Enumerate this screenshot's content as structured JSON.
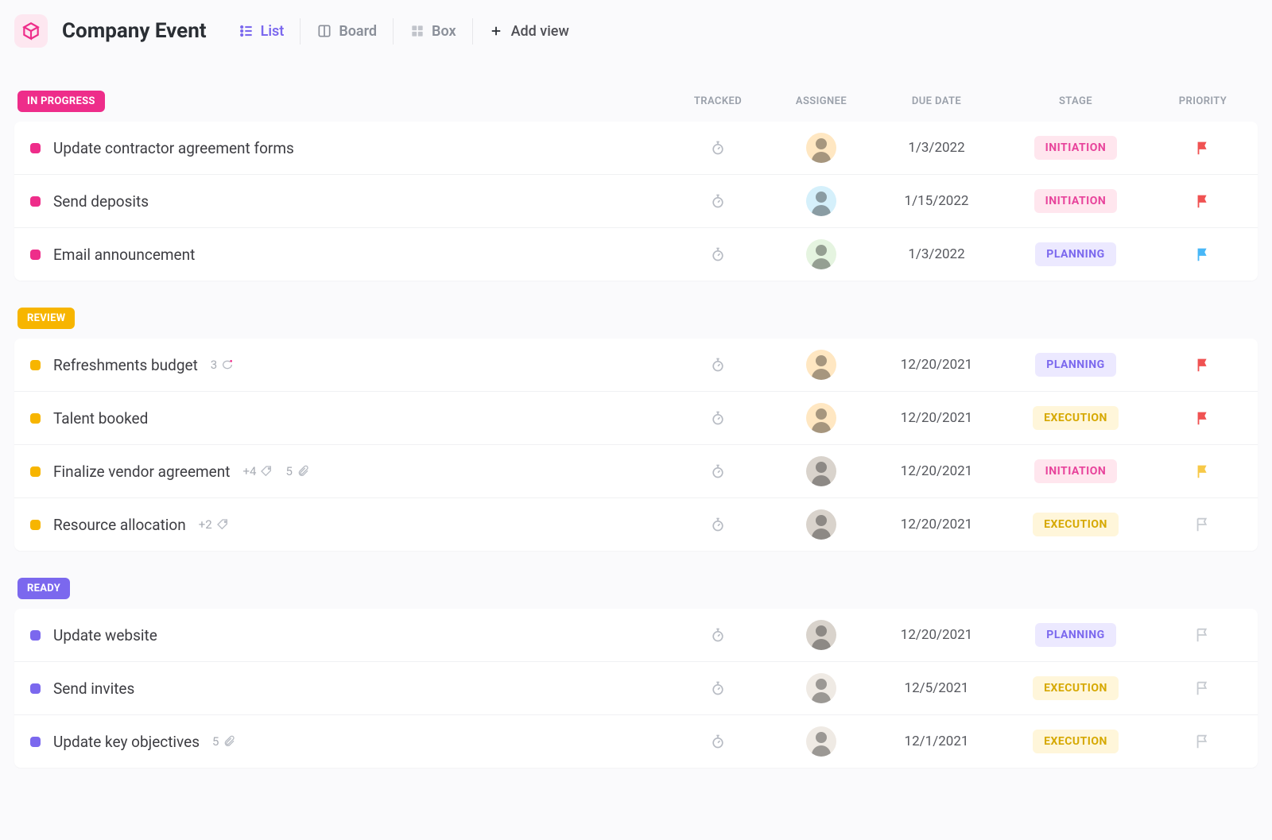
{
  "header": {
    "space_title": "Company Event",
    "views": [
      {
        "label": "List",
        "active": true
      },
      {
        "label": "Board",
        "active": false
      },
      {
        "label": "Box",
        "active": false
      }
    ],
    "add_view_label": "Add view"
  },
  "columns": {
    "tracked": "TRACKED",
    "assignee": "ASSIGNEE",
    "due_date": "DUE DATE",
    "stage": "STAGE",
    "priority": "PRIORITY"
  },
  "stages": {
    "INITIATION": {
      "bg": "#ffe6ee",
      "fg": "#e8439b"
    },
    "PLANNING": {
      "bg": "#ece9ff",
      "fg": "#7b68ee"
    },
    "EXECUTION": {
      "bg": "#fff6da",
      "fg": "#d6a800"
    }
  },
  "priorities": {
    "urgent": "#f05252",
    "normal": "#48b7f7",
    "medium": "#f7c948",
    "none": "#c7cbd1"
  },
  "avatars": {
    "a1": "#ffe7c2",
    "a2": "#d5f0fb",
    "a3": "#e5f4e0",
    "a4": "#ffe7c2",
    "a5": "#d9d3cc",
    "a6": "#efeae4"
  },
  "sections": [
    {
      "status_label": "IN PROGRESS",
      "status_color": "#ee2d8a",
      "tasks": [
        {
          "name": "Update contractor agreement forms",
          "due": "1/3/2022",
          "stage": "INITIATION",
          "priority": "urgent",
          "avatar": "a1"
        },
        {
          "name": "Send deposits",
          "due": "1/15/2022",
          "stage": "INITIATION",
          "priority": "urgent",
          "avatar": "a2"
        },
        {
          "name": "Email announcement",
          "due": "1/3/2022",
          "stage": "PLANNING",
          "priority": "normal",
          "avatar": "a3"
        }
      ]
    },
    {
      "status_label": "REVIEW",
      "status_color": "#f7b500",
      "tasks": [
        {
          "name": "Refreshments budget",
          "due": "12/20/2021",
          "stage": "PLANNING",
          "priority": "urgent",
          "avatar": "a4",
          "comments": "3"
        },
        {
          "name": "Talent booked",
          "due": "12/20/2021",
          "stage": "EXECUTION",
          "priority": "urgent",
          "avatar": "a4"
        },
        {
          "name": "Finalize vendor agreement",
          "due": "12/20/2021",
          "stage": "INITIATION",
          "priority": "medium",
          "avatar": "a5",
          "tags": "+4",
          "attachments": "5"
        },
        {
          "name": "Resource allocation",
          "due": "12/20/2021",
          "stage": "EXECUTION",
          "priority": "none",
          "avatar": "a5",
          "tags": "+2"
        }
      ]
    },
    {
      "status_label": "READY",
      "status_color": "#7b68ee",
      "tasks": [
        {
          "name": "Update website",
          "due": "12/20/2021",
          "stage": "PLANNING",
          "priority": "none",
          "avatar": "a5"
        },
        {
          "name": "Send invites",
          "due": "12/5/2021",
          "stage": "EXECUTION",
          "priority": "none",
          "avatar": "a6"
        },
        {
          "name": "Update key objectives",
          "due": "12/1/2021",
          "stage": "EXECUTION",
          "priority": "none",
          "avatar": "a6",
          "attachments": "5"
        }
      ]
    }
  ]
}
